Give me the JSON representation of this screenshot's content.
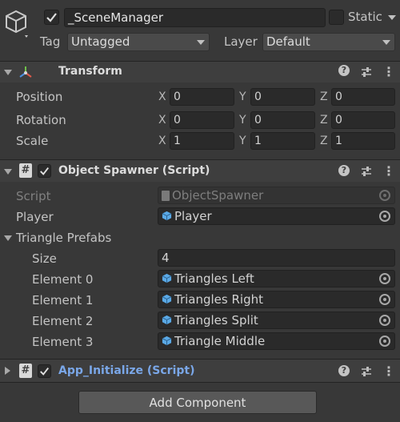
{
  "header": {
    "name": "_SceneManager",
    "static_label": "Static",
    "tag_label": "Tag",
    "tag_value": "Untagged",
    "layer_label": "Layer",
    "layer_value": "Default"
  },
  "transform": {
    "title": "Transform",
    "rows": [
      {
        "label": "Position",
        "x": "0",
        "y": "0",
        "z": "0"
      },
      {
        "label": "Rotation",
        "x": "0",
        "y": "0",
        "z": "0"
      },
      {
        "label": "Scale",
        "x": "1",
        "y": "1",
        "z": "1"
      }
    ],
    "axes": {
      "x": "X",
      "y": "Y",
      "z": "Z"
    }
  },
  "spawner": {
    "title": "Object Spawner (Script)",
    "script_label": "Script",
    "script_value": "ObjectSpawner",
    "player_label": "Player",
    "player_value": "Player",
    "prefabs_label": "Triangle Prefabs",
    "size_label": "Size",
    "size_value": "4",
    "elements": [
      {
        "label": "Element 0",
        "value": "Triangles Left"
      },
      {
        "label": "Element 1",
        "value": "Triangles Right"
      },
      {
        "label": "Element 2",
        "value": "Triangles Split"
      },
      {
        "label": "Element 3",
        "value": "Triangle Middle"
      }
    ]
  },
  "app_init": {
    "title": "App_Initialize (Script)"
  },
  "add_component_label": "Add Component",
  "icons": {
    "help": "?",
    "more": "⋮"
  },
  "colors": {
    "background": "#383838",
    "header": "#3e3e3e",
    "field": "#2a2a2a",
    "link_title": "#7aa7e8",
    "prefab_icon": "#5aa9e6"
  }
}
